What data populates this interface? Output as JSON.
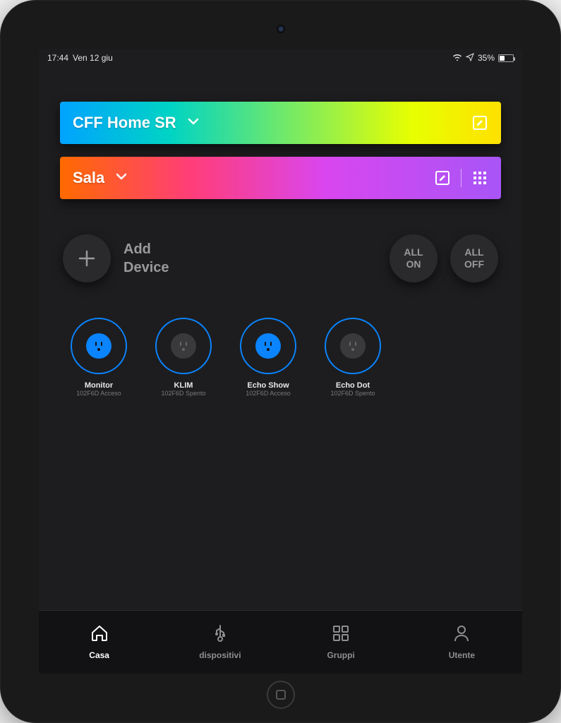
{
  "status": {
    "time": "17:44",
    "date": "Ven 12 giu",
    "battery": "35%"
  },
  "home": {
    "name": "CFF Home SR"
  },
  "room": {
    "name": "Sala"
  },
  "controls": {
    "add_label": "Add\nDevice",
    "all_on": "ALL ON",
    "all_off": "ALL OFF"
  },
  "devices": [
    {
      "name": "Monitor",
      "status": "102F6D Acceso",
      "on": true
    },
    {
      "name": "KLIM",
      "status": "102F6D Spento",
      "on": false
    },
    {
      "name": "Echo Show",
      "status": "102F6D Acceso",
      "on": true
    },
    {
      "name": "Echo Dot",
      "status": "102F6D Spento",
      "on": false
    }
  ],
  "tabs": {
    "home": "Casa",
    "devices": "dispositivi",
    "groups": "Gruppi",
    "user": "Utente"
  }
}
